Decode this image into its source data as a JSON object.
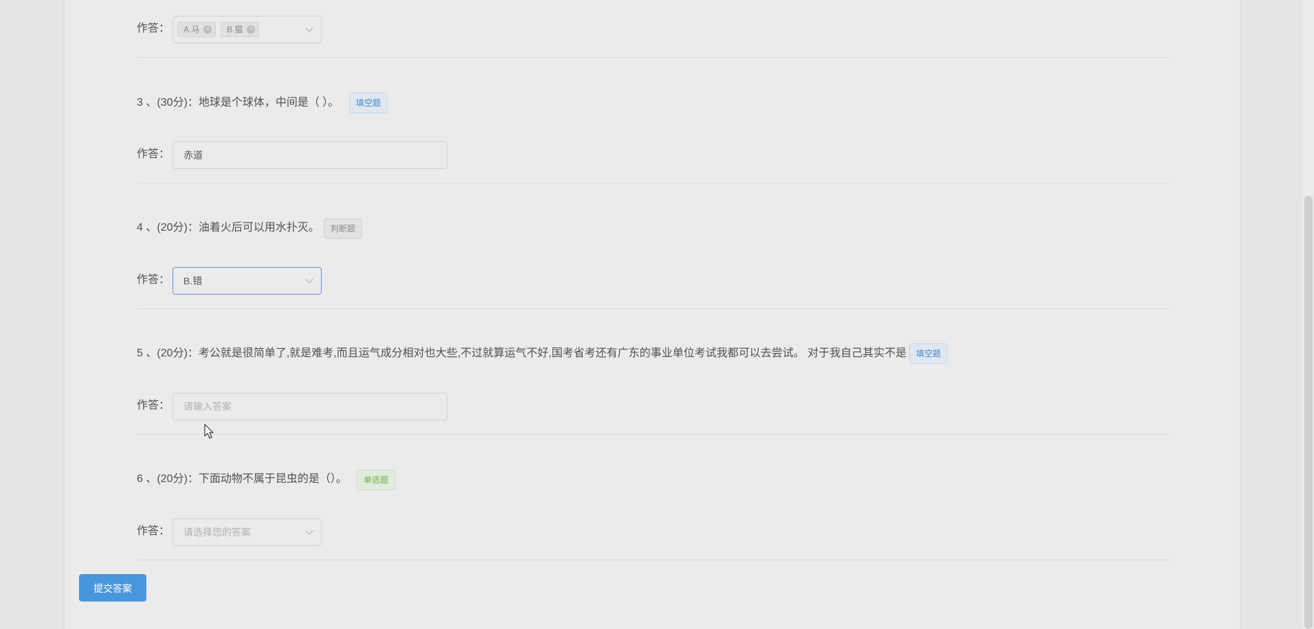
{
  "answer_label": "作答：",
  "q2": {
    "selected": [
      {
        "label": "A.马"
      },
      {
        "label": "B.猫"
      }
    ]
  },
  "q3": {
    "number": "3",
    "score": "(30分)",
    "text": "地球是个球体，中间是（ ）。",
    "tag": "填空题",
    "value": "赤道"
  },
  "q4": {
    "number": "4",
    "score": "(20分)",
    "text": "油着火后可以用水扑灭。",
    "tag": "判断题",
    "selected": "B.错"
  },
  "q5": {
    "number": "5",
    "score": "(20分)",
    "text": "考公就是很简单了,就是难考,而且运气成分相对也大些,不过就算运气不好,国考省考还有广东的事业单位考试我都可以去尝试。 对于我自己其实不是",
    "tag": "填空题",
    "placeholder": "请输入答案"
  },
  "q6": {
    "number": "6",
    "score": "(20分)",
    "text": "下面动物不属于昆虫的是（）。",
    "tag": "单选题",
    "placeholder": "请选择您的答案"
  },
  "submit_label": "提交答案",
  "colors": {
    "primary": "#4a96dc",
    "tag_blue": "#4a88c8",
    "tag_green": "#6ab24a",
    "tag_gray": "#8c8c8c"
  }
}
